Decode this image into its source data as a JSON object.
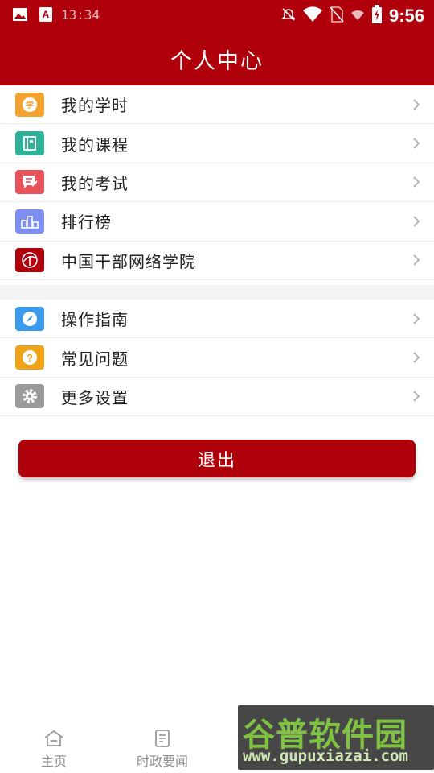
{
  "status_bar": {
    "time_small": "13:34",
    "clock": "9:56",
    "icons": [
      "image-icon",
      "app-a-icon",
      "alarm-off-icon",
      "wifi-icon",
      "no-sim-icon",
      "wifi-small-icon",
      "battery-icon"
    ]
  },
  "header": {
    "title": "个人中心"
  },
  "menu_group1": [
    {
      "label": "我的学时",
      "icon": "study-hours-icon",
      "color": "#f4a330"
    },
    {
      "label": "我的课程",
      "icon": "course-book-icon",
      "color": "#2eb39a"
    },
    {
      "label": "我的考试",
      "icon": "exam-icon",
      "color": "#e8535b"
    },
    {
      "label": "排行榜",
      "icon": "ranking-icon",
      "color": "#7d8ff0"
    },
    {
      "label": "中国干部网络学院",
      "icon": "college-logo-icon",
      "color": "#b0000b"
    }
  ],
  "menu_group2": [
    {
      "label": "操作指南",
      "icon": "compass-icon",
      "color": "#3a9bee"
    },
    {
      "label": "常见问题",
      "icon": "question-icon",
      "color": "#f0a318"
    },
    {
      "label": "更多设置",
      "icon": "gear-icon",
      "color": "#9a9a9a"
    }
  ],
  "logout_label": "退出",
  "bottom_nav": [
    {
      "label": "主页",
      "icon": "home-icon"
    },
    {
      "label": "时政要闻",
      "icon": "news-icon"
    }
  ],
  "watermark": {
    "brand": "谷普软件园",
    "url": "www.gupuxiazai.com"
  },
  "colors": {
    "primary": "#b0000b",
    "text": "#222222",
    "muted": "#8e8e8e"
  }
}
